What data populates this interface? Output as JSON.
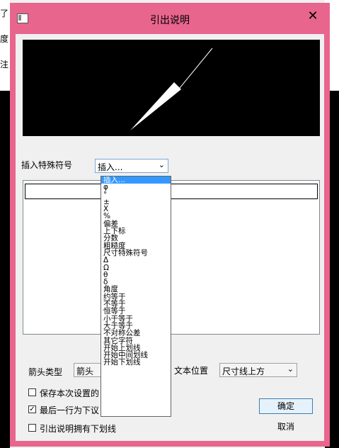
{
  "background": {
    "left_chars": [
      "了",
      "度",
      "注"
    ]
  },
  "dialog": {
    "title": "引出说明",
    "close_glyph": "✕",
    "accent_color": "#e8658d"
  },
  "special_symbols": {
    "label": "插入特殊符号",
    "selected": "插入...",
    "options": [
      "插入...",
      "φ",
      "°",
      "±",
      "X",
      "%",
      "偏差",
      "上下标",
      "分数",
      "粗糙度",
      "尺寸特殊符号",
      "Δ",
      "Ω",
      "θ",
      "δ",
      "角度",
      "约等于",
      "不等于",
      "恒等于",
      "小于等于",
      "大于等于",
      "不对称公差",
      "其它字符",
      "开始上划线",
      "开始中间划线",
      "开始下划线"
    ]
  },
  "arrow_type": {
    "label": "箭头类型",
    "value": "箭头"
  },
  "text_position": {
    "label": "文本位置",
    "value": "尺寸线上方"
  },
  "checkboxes": [
    {
      "label": "保存本次设置的",
      "checked": false
    },
    {
      "label": "最后一行为下议",
      "checked": true
    },
    {
      "label": "引出说明拥有下划线",
      "checked": false
    }
  ],
  "buttons": {
    "ok": "确定",
    "cancel": "取消"
  }
}
